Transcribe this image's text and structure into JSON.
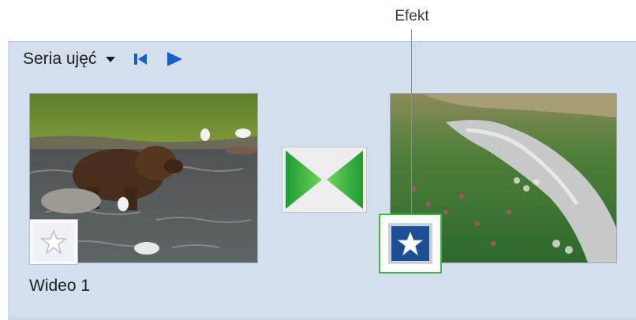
{
  "callout": {
    "label": "Efekt"
  },
  "storyboard": {
    "view_mode_label": "Seria ujęć",
    "buttons": [
      "dropdown-arrow-icon",
      "skip-to-start-icon",
      "play-icon"
    ]
  },
  "clips": [
    {
      "title": "Wideo 1",
      "scene": "bear-in-river"
    },
    {
      "title": "",
      "scene": "mountain-stream-meadow"
    }
  ],
  "transition": {
    "icon": "wipe-transition-icon"
  },
  "effects": {
    "empty_icon": "star-icon",
    "applied_icon": "star-icon"
  },
  "colors": {
    "panel": "#d3dfec",
    "transition_green": "#2eb33c",
    "effect_border": "#40b548",
    "accent_blue": "#1560c8"
  }
}
